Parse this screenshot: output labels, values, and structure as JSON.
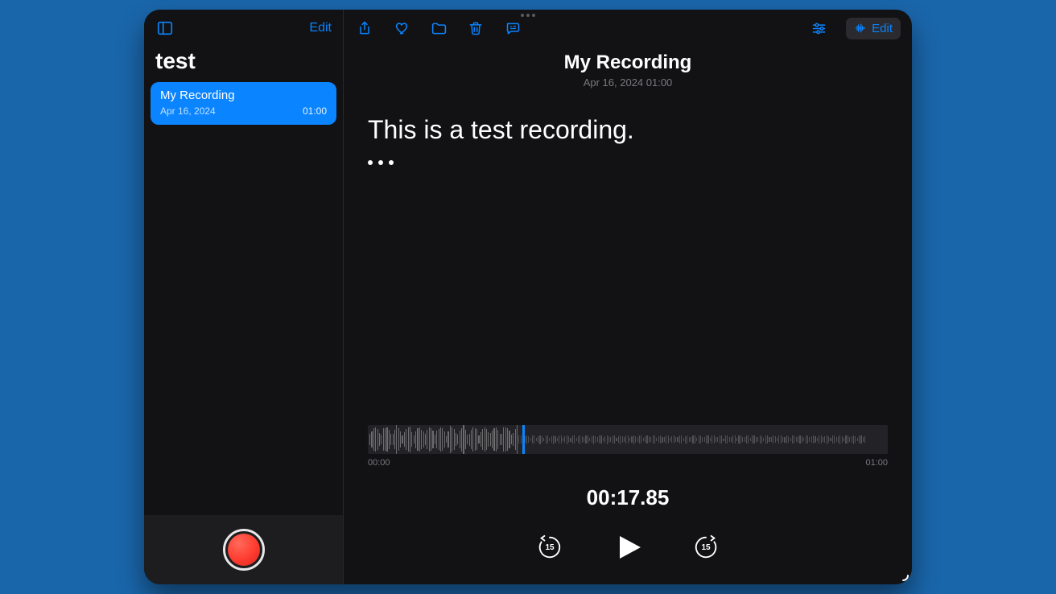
{
  "accent": "#0a84ff",
  "sidebar": {
    "edit_label": "Edit",
    "folder_title": "test",
    "items": [
      {
        "title": "My Recording",
        "date": "Apr 16, 2024",
        "duration": "01:00"
      }
    ]
  },
  "detail": {
    "title": "My Recording",
    "subtitle": "Apr 16, 2024  01:00",
    "edit_label": "Edit",
    "transcript": "This is a test recording.",
    "waveform": {
      "start_label": "00:00",
      "end_label": "01:00",
      "playhead_fraction": 0.2975
    },
    "current_time": "00:17.85",
    "skip_seconds": "15"
  }
}
